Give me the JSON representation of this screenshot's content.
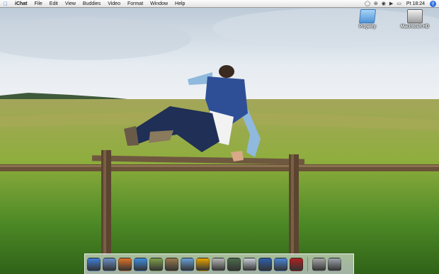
{
  "menubar": {
    "apple_icon": "apple-icon",
    "items": [
      "iChat",
      "File",
      "Edit",
      "View",
      "Buddies",
      "Video",
      "Format",
      "Window",
      "Help"
    ],
    "clock": "Pt 18:24",
    "status_icons": [
      "ichat-status-icon",
      "bluetooth-icon",
      "wifi-icon",
      "volume-icon",
      "battery-icon",
      "spotlight-icon"
    ]
  },
  "desktop": {
    "icons": [
      {
        "label": "Projekty",
        "icon": "folder-icon"
      },
      {
        "label": "Macintosh HD",
        "icon": "hard-drive-icon"
      }
    ]
  },
  "dock": {
    "apps": [
      {
        "name": "finder-icon",
        "color": "#3f7fd8"
      },
      {
        "name": "preview-icon",
        "color": "#6a8fc8"
      },
      {
        "name": "firefox-icon",
        "color": "#e0722a"
      },
      {
        "name": "ichat-icon",
        "color": "#3d8fe0"
      },
      {
        "name": "textedit-icon",
        "color": "#7ea04a"
      },
      {
        "name": "dictionary-icon",
        "color": "#9a7a4e"
      },
      {
        "name": "mail-icon",
        "color": "#6aa0d8"
      },
      {
        "name": "vlc-icon",
        "color": "#e8a400"
      },
      {
        "name": "address-book-icon",
        "color": "#b8b8b8"
      },
      {
        "name": "iphoto-icon",
        "color": "#4b6b4b"
      },
      {
        "name": "idvd-icon",
        "color": "#c8d0d8"
      },
      {
        "name": "imovie-icon",
        "color": "#2f5fae"
      },
      {
        "name": "itunes-icon",
        "color": "#4a86d6"
      },
      {
        "name": "photo-booth-icon",
        "color": "#b02020"
      }
    ],
    "right": [
      {
        "name": "disk-utility-icon",
        "color": "#a8a8a8"
      },
      {
        "name": "trash-icon",
        "color": "#9ea4ab"
      }
    ]
  }
}
